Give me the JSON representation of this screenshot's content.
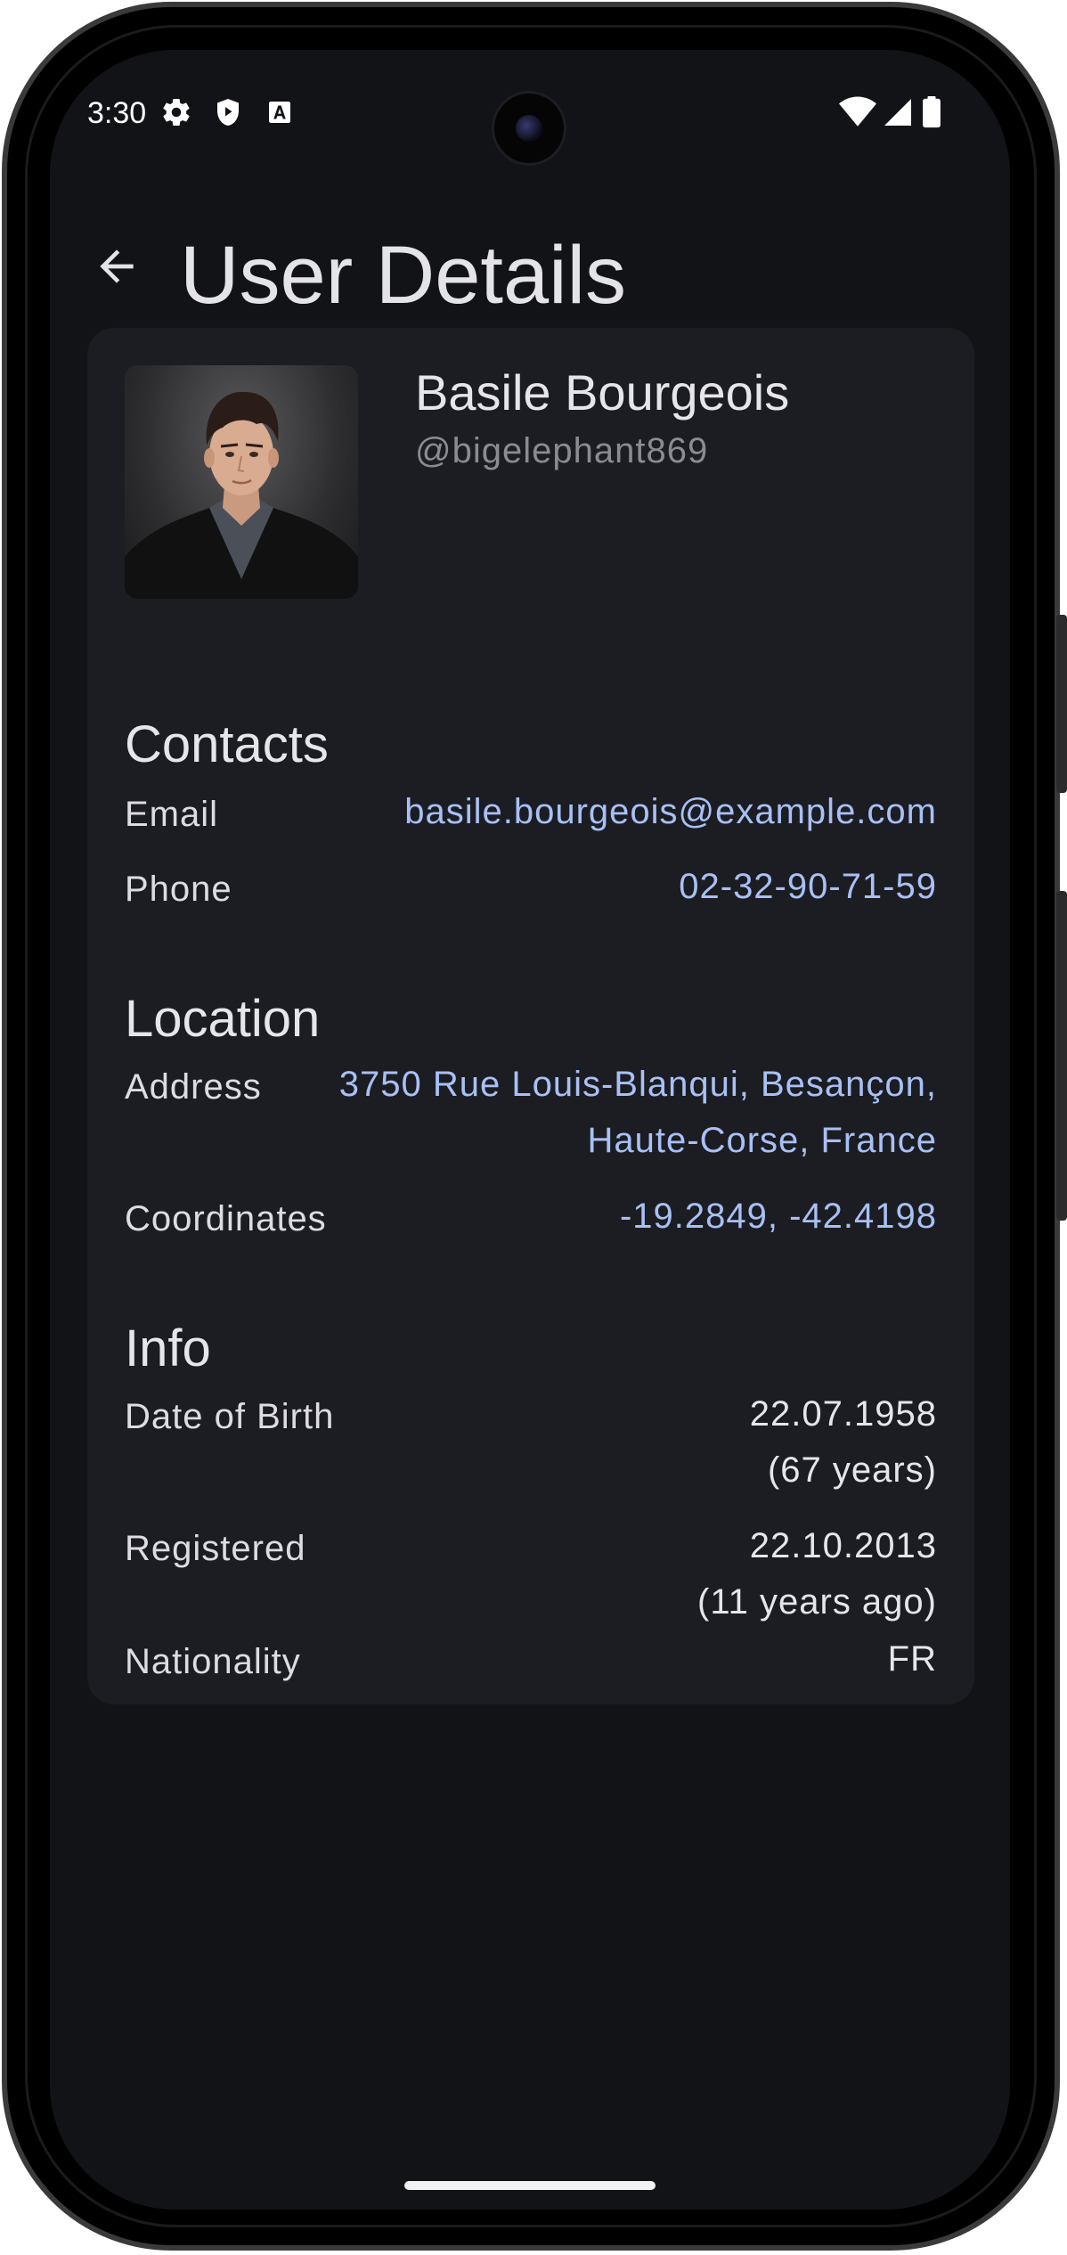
{
  "status_bar": {
    "time": "3:30",
    "left_icons": [
      "gear-icon",
      "shield-play-icon",
      "font-a-icon"
    ],
    "right_icons": [
      "wifi-icon",
      "signal-icon",
      "battery-icon"
    ]
  },
  "app_bar": {
    "back_icon": "arrow-left-icon",
    "title": "User Details"
  },
  "profile": {
    "name": "Basile Bourgeois",
    "username": "@bigelephant869"
  },
  "sections": {
    "contacts": {
      "title": "Contacts",
      "email_label": "Email",
      "email_value": "basile.bourgeois@example.com",
      "phone_label": "Phone",
      "phone_value": "02-32-90-71-59"
    },
    "location": {
      "title": "Location",
      "address_label": "Address",
      "address_line1": "3750 Rue Louis-Blanqui, Besançon,",
      "address_line2": "Haute-Corse, France",
      "coordinates_label": "Coordinates",
      "coordinates_value": "-19.2849, -42.4198"
    },
    "info": {
      "title": "Info",
      "dob_label": "Date of Birth",
      "dob_date": "22.07.1958",
      "dob_age": "(67 years)",
      "registered_label": "Registered",
      "registered_date": "22.10.2013",
      "registered_ago": "(11 years ago)",
      "nationality_label": "Nationality",
      "nationality_value": "FR"
    }
  },
  "colors": {
    "background": "#121316",
    "card": "#1c1d22",
    "link": "#a8c0f5",
    "text_primary": "#e6e6ea",
    "text_secondary": "#8a8b93"
  }
}
